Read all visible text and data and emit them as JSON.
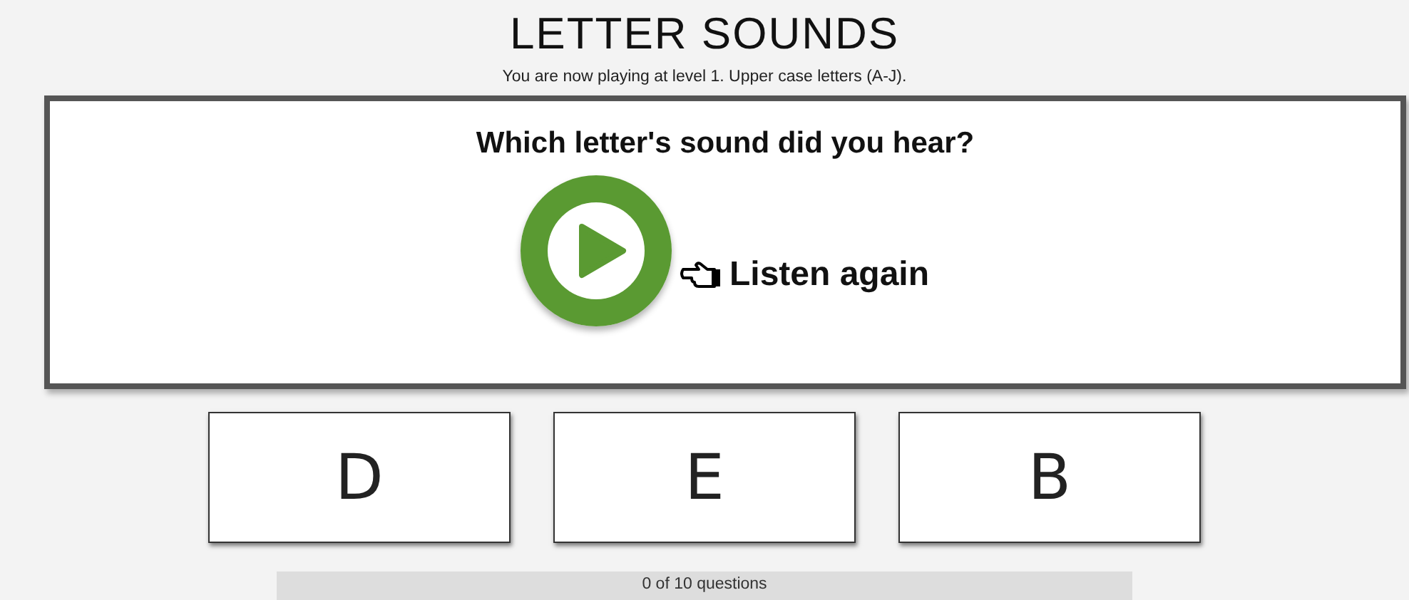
{
  "header": {
    "title": "LETTER SOUNDS",
    "subtitle": "You are now playing at level 1. Upper case letters (A-J)."
  },
  "question": {
    "prompt": "Which letter's sound did you hear?",
    "listen_label": "Listen again"
  },
  "answers": [
    {
      "letter": "D"
    },
    {
      "letter": "E"
    },
    {
      "letter": "B"
    }
  ],
  "progress": {
    "label": "0 of 10 questions",
    "level": 0
  }
}
